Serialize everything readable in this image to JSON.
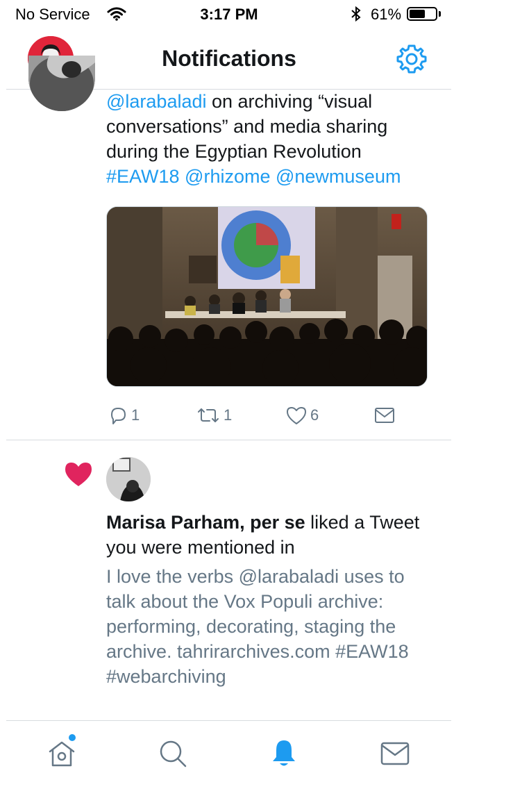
{
  "status_bar": {
    "carrier": "No Service",
    "time": "3:17 PM",
    "battery_percent": "61%",
    "battery_level": 0.61
  },
  "header": {
    "title": "Notifications"
  },
  "tweet": {
    "text_parts": [
      {
        "text": "@larabaladi",
        "link": true
      },
      {
        "text": " on archiving “visual conversations” and media sharing during the Egyptian Revolution ",
        "link": false
      },
      {
        "text": "#EAW18 @rhizome @newmuseum",
        "link": true
      }
    ],
    "media_icon": "photo-of-panel-on-stage",
    "replies": "1",
    "retweets": "1",
    "likes": "6"
  },
  "notification": {
    "actor": "Marisa Parham, per se",
    "action": " liked a Tweet you were mentioned in",
    "body": "I love the verbs @larabaladi uses to talk about the Vox Populi archive: performing, decorating, staging the archive. tahrirarchives.com #EAW18 #webarchiving"
  },
  "tab_bar": {
    "items": [
      "home-icon",
      "search-icon",
      "notifications-icon",
      "messages-icon"
    ],
    "active": "notifications-icon"
  },
  "colors": {
    "accent": "#1d9bf0",
    "like": "#e0245e",
    "secondary_text": "#657786"
  }
}
